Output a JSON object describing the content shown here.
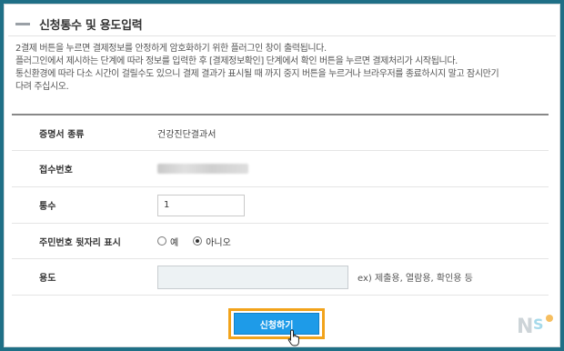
{
  "section": {
    "title": "신청통수 및 용도입력"
  },
  "notice": {
    "lines": [
      "2결제 버튼을 누르면 결제정보를 안정하게 암호화하기 위한 플러그인 창이 출력됩니다.",
      "플러그인에서 제시하는 단계에 따라 정보를 입력한 후 [결제정보확인] 단계에서 확인 버튼을 누르면 결제처리가 시작됩니다.",
      "통신환경에 따라 다소 시간이 걸릴수도 있으니 결제 결과가 표시될 때 까지 중지 버튼을 누르거나 브라우저를 종료하시지 말고 잠시만기",
      "다려 주십시오."
    ]
  },
  "form": {
    "cert_type": {
      "label": "증명서 종류",
      "value": "건강진단결과서"
    },
    "receipt_no": {
      "label": "접수번호"
    },
    "copies": {
      "label": "통수",
      "value": "1"
    },
    "ssn_suffix": {
      "label": "주민번호 뒷자리 표시",
      "options": [
        "예",
        "아니오"
      ],
      "selected": "아니오"
    },
    "purpose": {
      "label": "용도",
      "value": "",
      "hint": "ex) 제출용, 열람용, 확인용 등"
    }
  },
  "submit": {
    "label": "신청하기"
  },
  "colors": {
    "accent": "#1e9be8",
    "highlight": "#f2a31b",
    "background": "#1f6f86"
  },
  "icons": {
    "cursor": "hand-pointer-icon",
    "watermark": "ns-logo"
  }
}
